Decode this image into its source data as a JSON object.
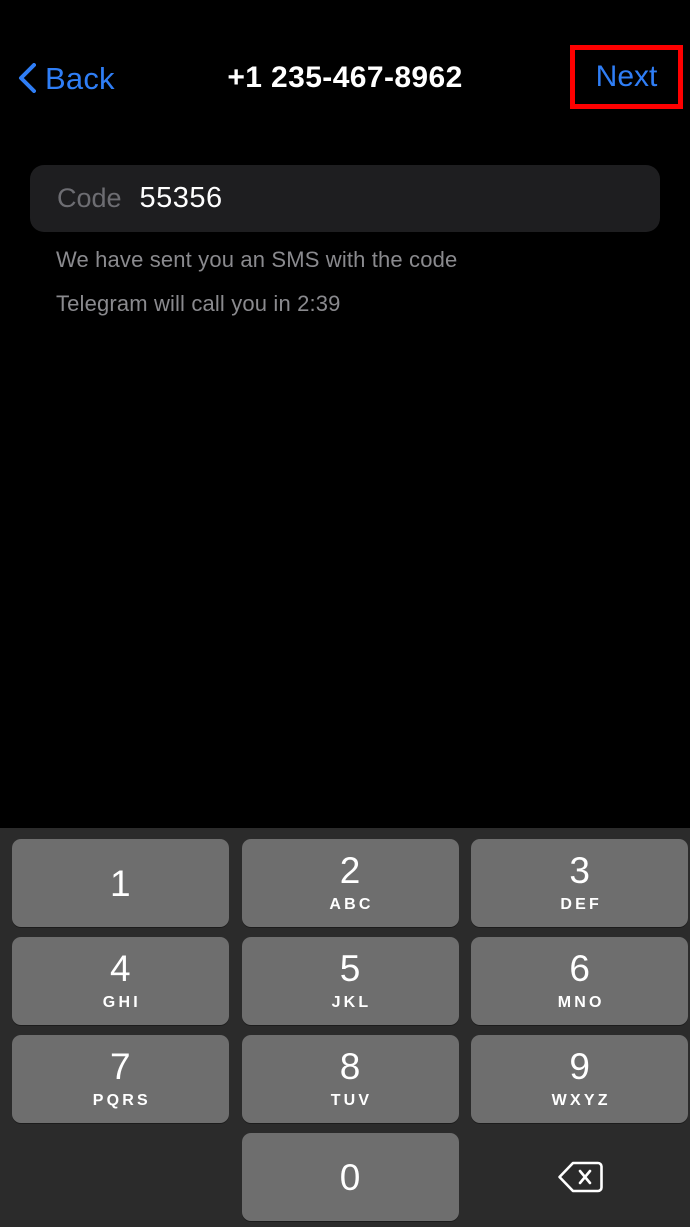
{
  "app": {
    "name": "Telegram",
    "theme": "dark",
    "background_color": "#000000"
  },
  "header": {
    "back_label": "Back",
    "back_icon": "chevron-left-icon",
    "title": "+1 235-467-8962",
    "next_label": "Next",
    "accent_color": "#2f7ef6",
    "highlight_color": "#fe0000"
  },
  "code_field": {
    "label": "Code",
    "value": "55356",
    "placeholder": "Code",
    "background_color": "#1e1e20",
    "label_color": "#6d6d72",
    "value_color": "#ffffff"
  },
  "hints": {
    "sms": "We have sent you an SMS with the code",
    "call": "Telegram will call you in 2:39",
    "color": "#8a8a8e"
  },
  "keypad": {
    "background_color": "#2b2b2b",
    "key_color": "#6e6e6e",
    "key_text_color": "#ffffff",
    "backspace_icon": "backspace-icon",
    "rows": [
      [
        {
          "digit": "1",
          "letters": ""
        },
        {
          "digit": "2",
          "letters": "ABC"
        },
        {
          "digit": "3",
          "letters": "DEF"
        }
      ],
      [
        {
          "digit": "4",
          "letters": "GHI"
        },
        {
          "digit": "5",
          "letters": "JKL"
        },
        {
          "digit": "6",
          "letters": "MNO"
        }
      ],
      [
        {
          "digit": "7",
          "letters": "PQRS"
        },
        {
          "digit": "8",
          "letters": "TUV"
        },
        {
          "digit": "9",
          "letters": "WXYZ"
        }
      ],
      [
        {
          "digit": "",
          "letters": ""
        },
        {
          "digit": "0",
          "letters": ""
        },
        {
          "digit": "",
          "letters": ""
        }
      ]
    ]
  }
}
